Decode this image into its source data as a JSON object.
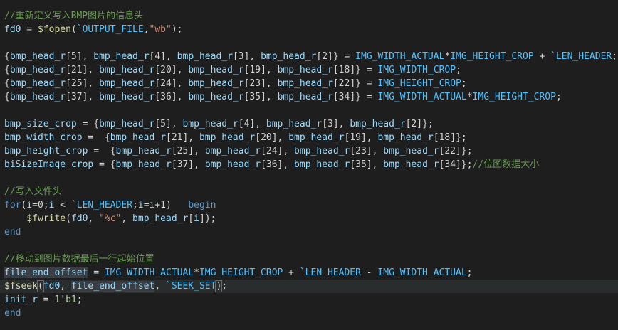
{
  "editor": {
    "colors": {
      "background": "#1e1e1e",
      "comment": "#6a9955",
      "keyword": "#569cd6",
      "variable": "#9cdcfe",
      "function": "#dcdcaa",
      "string": "#ce9178",
      "macro": "#4fc1ff",
      "number": "#b5cea8",
      "plain": "#d4d4d4"
    },
    "lines": [
      [
        {
          "t": "comment",
          "v": "//重新定义写入BMP图片的信息头"
        }
      ],
      [
        {
          "t": "var",
          "v": "fd0"
        },
        {
          "t": "plain",
          "v": " = "
        },
        {
          "t": "func",
          "v": "$fopen"
        },
        {
          "t": "plain",
          "v": "("
        },
        {
          "t": "macro",
          "v": "`OUTPUT_FILE"
        },
        {
          "t": "plain",
          "v": ","
        },
        {
          "t": "string",
          "v": "\"wb\""
        },
        {
          "t": "plain",
          "v": ");"
        }
      ],
      [],
      [
        {
          "t": "plain",
          "v": "{"
        },
        {
          "t": "var",
          "v": "bmp_head_r"
        },
        {
          "t": "plain",
          "v": "[5], "
        },
        {
          "t": "var",
          "v": "bmp_head_r"
        },
        {
          "t": "plain",
          "v": "[4], "
        },
        {
          "t": "var",
          "v": "bmp_head_r"
        },
        {
          "t": "plain",
          "v": "[3], "
        },
        {
          "t": "var",
          "v": "bmp_head_r"
        },
        {
          "t": "plain",
          "v": "[2]} = "
        },
        {
          "t": "macro",
          "v": "IMG_WIDTH_ACTUAL"
        },
        {
          "t": "plain",
          "v": "*"
        },
        {
          "t": "macro",
          "v": "IMG_HEIGHT_CROP"
        },
        {
          "t": "plain",
          "v": " + "
        },
        {
          "t": "macro",
          "v": "`LEN_HEADER"
        },
        {
          "t": "plain",
          "v": ";"
        }
      ],
      [
        {
          "t": "plain",
          "v": "{"
        },
        {
          "t": "var",
          "v": "bmp_head_r"
        },
        {
          "t": "plain",
          "v": "[21], "
        },
        {
          "t": "var",
          "v": "bmp_head_r"
        },
        {
          "t": "plain",
          "v": "[20], "
        },
        {
          "t": "var",
          "v": "bmp_head_r"
        },
        {
          "t": "plain",
          "v": "[19], "
        },
        {
          "t": "var",
          "v": "bmp_head_r"
        },
        {
          "t": "plain",
          "v": "[18]} = "
        },
        {
          "t": "macro",
          "v": "IMG_WIDTH_CROP"
        },
        {
          "t": "plain",
          "v": ";"
        }
      ],
      [
        {
          "t": "plain",
          "v": "{"
        },
        {
          "t": "var",
          "v": "bmp_head_r"
        },
        {
          "t": "plain",
          "v": "[25], "
        },
        {
          "t": "var",
          "v": "bmp_head_r"
        },
        {
          "t": "plain",
          "v": "[24], "
        },
        {
          "t": "var",
          "v": "bmp_head_r"
        },
        {
          "t": "plain",
          "v": "[23], "
        },
        {
          "t": "var",
          "v": "bmp_head_r"
        },
        {
          "t": "plain",
          "v": "[22]} = "
        },
        {
          "t": "macro",
          "v": "IMG_HEIGHT_CROP"
        },
        {
          "t": "plain",
          "v": ";"
        }
      ],
      [
        {
          "t": "plain",
          "v": "{"
        },
        {
          "t": "var",
          "v": "bmp_head_r"
        },
        {
          "t": "plain",
          "v": "[37], "
        },
        {
          "t": "var",
          "v": "bmp_head_r"
        },
        {
          "t": "plain",
          "v": "[36], "
        },
        {
          "t": "var",
          "v": "bmp_head_r"
        },
        {
          "t": "plain",
          "v": "[35], "
        },
        {
          "t": "var",
          "v": "bmp_head_r"
        },
        {
          "t": "plain",
          "v": "[34]} = "
        },
        {
          "t": "macro",
          "v": "IMG_WIDTH_ACTUAL"
        },
        {
          "t": "plain",
          "v": "*"
        },
        {
          "t": "macro",
          "v": "IMG_HEIGHT_CROP"
        },
        {
          "t": "plain",
          "v": ";"
        }
      ],
      [],
      [
        {
          "t": "var",
          "v": "bmp_size_crop"
        },
        {
          "t": "plain",
          "v": " = {"
        },
        {
          "t": "var",
          "v": "bmp_head_r"
        },
        {
          "t": "plain",
          "v": "[5], "
        },
        {
          "t": "var",
          "v": "bmp_head_r"
        },
        {
          "t": "plain",
          "v": "[4], "
        },
        {
          "t": "var",
          "v": "bmp_head_r"
        },
        {
          "t": "plain",
          "v": "[3], "
        },
        {
          "t": "var",
          "v": "bmp_head_r"
        },
        {
          "t": "plain",
          "v": "[2]};"
        }
      ],
      [
        {
          "t": "var",
          "v": "bmp_width_crop"
        },
        {
          "t": "plain",
          "v": " =  {"
        },
        {
          "t": "var",
          "v": "bmp_head_r"
        },
        {
          "t": "plain",
          "v": "[21], "
        },
        {
          "t": "var",
          "v": "bmp_head_r"
        },
        {
          "t": "plain",
          "v": "[20], "
        },
        {
          "t": "var",
          "v": "bmp_head_r"
        },
        {
          "t": "plain",
          "v": "[19], "
        },
        {
          "t": "var",
          "v": "bmp_head_r"
        },
        {
          "t": "plain",
          "v": "[18]};"
        }
      ],
      [
        {
          "t": "var",
          "v": "bmp_height_crop"
        },
        {
          "t": "plain",
          "v": " =  {"
        },
        {
          "t": "var",
          "v": "bmp_head_r"
        },
        {
          "t": "plain",
          "v": "[25], "
        },
        {
          "t": "var",
          "v": "bmp_head_r"
        },
        {
          "t": "plain",
          "v": "[24], "
        },
        {
          "t": "var",
          "v": "bmp_head_r"
        },
        {
          "t": "plain",
          "v": "[23], "
        },
        {
          "t": "var",
          "v": "bmp_head_r"
        },
        {
          "t": "plain",
          "v": "[22]};"
        }
      ],
      [
        {
          "t": "var",
          "v": "biSizeImage_crop"
        },
        {
          "t": "plain",
          "v": " = {"
        },
        {
          "t": "var",
          "v": "bmp_head_r"
        },
        {
          "t": "plain",
          "v": "[37], "
        },
        {
          "t": "var",
          "v": "bmp_head_r"
        },
        {
          "t": "plain",
          "v": "[36], "
        },
        {
          "t": "var",
          "v": "bmp_head_r"
        },
        {
          "t": "plain",
          "v": "[35], "
        },
        {
          "t": "var",
          "v": "bmp_head_r"
        },
        {
          "t": "plain",
          "v": "[34]};"
        },
        {
          "t": "comment",
          "v": "//位图数据大小"
        }
      ],
      [],
      [
        {
          "t": "comment",
          "v": "//写入文件头"
        }
      ],
      [
        {
          "t": "keyword",
          "v": "for"
        },
        {
          "t": "plain",
          "v": "("
        },
        {
          "t": "var",
          "v": "i"
        },
        {
          "t": "plain",
          "v": "=0;"
        },
        {
          "t": "var",
          "v": "i"
        },
        {
          "t": "plain",
          "v": " < "
        },
        {
          "t": "macro",
          "v": "`LEN_HEADER"
        },
        {
          "t": "plain",
          "v": ";"
        },
        {
          "t": "var",
          "v": "i"
        },
        {
          "t": "plain",
          "v": "="
        },
        {
          "t": "var",
          "v": "i"
        },
        {
          "t": "plain",
          "v": "+1)   "
        },
        {
          "t": "keyword",
          "v": "begin"
        }
      ],
      [
        {
          "t": "plain",
          "v": "    "
        },
        {
          "t": "func",
          "v": "$fwrite"
        },
        {
          "t": "plain",
          "v": "("
        },
        {
          "t": "var",
          "v": "fd0"
        },
        {
          "t": "plain",
          "v": ", "
        },
        {
          "t": "string",
          "v": "\"%c\""
        },
        {
          "t": "plain",
          "v": ", "
        },
        {
          "t": "var",
          "v": "bmp_head_r"
        },
        {
          "t": "plain",
          "v": "["
        },
        {
          "t": "var",
          "v": "i"
        },
        {
          "t": "plain",
          "v": "]);"
        }
      ],
      [
        {
          "t": "keyword",
          "v": "end"
        }
      ],
      [],
      [
        {
          "t": "comment",
          "v": "//移动到图片数据最后一行起始位置"
        }
      ],
      [
        {
          "t": "var",
          "v": "file_end_offset",
          "sel": true
        },
        {
          "t": "plain",
          "v": " = "
        },
        {
          "t": "macro",
          "v": "IMG_WIDTH_ACTUAL"
        },
        {
          "t": "plain",
          "v": "*"
        },
        {
          "t": "macro",
          "v": "IMG_HEIGHT_CROP"
        },
        {
          "t": "plain",
          "v": " + "
        },
        {
          "t": "macro",
          "v": "`LEN_HEADER"
        },
        {
          "t": "plain",
          "v": " - "
        },
        {
          "t": "macro",
          "v": "IMG_WIDTH_ACTUAL"
        },
        {
          "t": "plain",
          "v": ";"
        }
      ],
      [
        {
          "t": "func",
          "v": "$fseek"
        },
        {
          "t": "plain",
          "v": "(",
          "match": true
        },
        {
          "t": "var",
          "v": "fd0"
        },
        {
          "t": "plain",
          "v": ", "
        },
        {
          "t": "var",
          "v": "file_end_offset",
          "sel": true
        },
        {
          "t": "plain",
          "v": ", "
        },
        {
          "t": "macro",
          "v": "`SEEK_SET"
        },
        {
          "t": "plain",
          "v": ")",
          "match": true
        },
        {
          "t": "plain",
          "v": ";"
        }
      ],
      [
        {
          "t": "var",
          "v": "init_r"
        },
        {
          "t": "plain",
          "v": " = "
        },
        {
          "t": "number",
          "v": "1'b1"
        },
        {
          "t": "plain",
          "v": ";"
        }
      ],
      [
        {
          "t": "keyword",
          "v": "end"
        }
      ]
    ]
  }
}
